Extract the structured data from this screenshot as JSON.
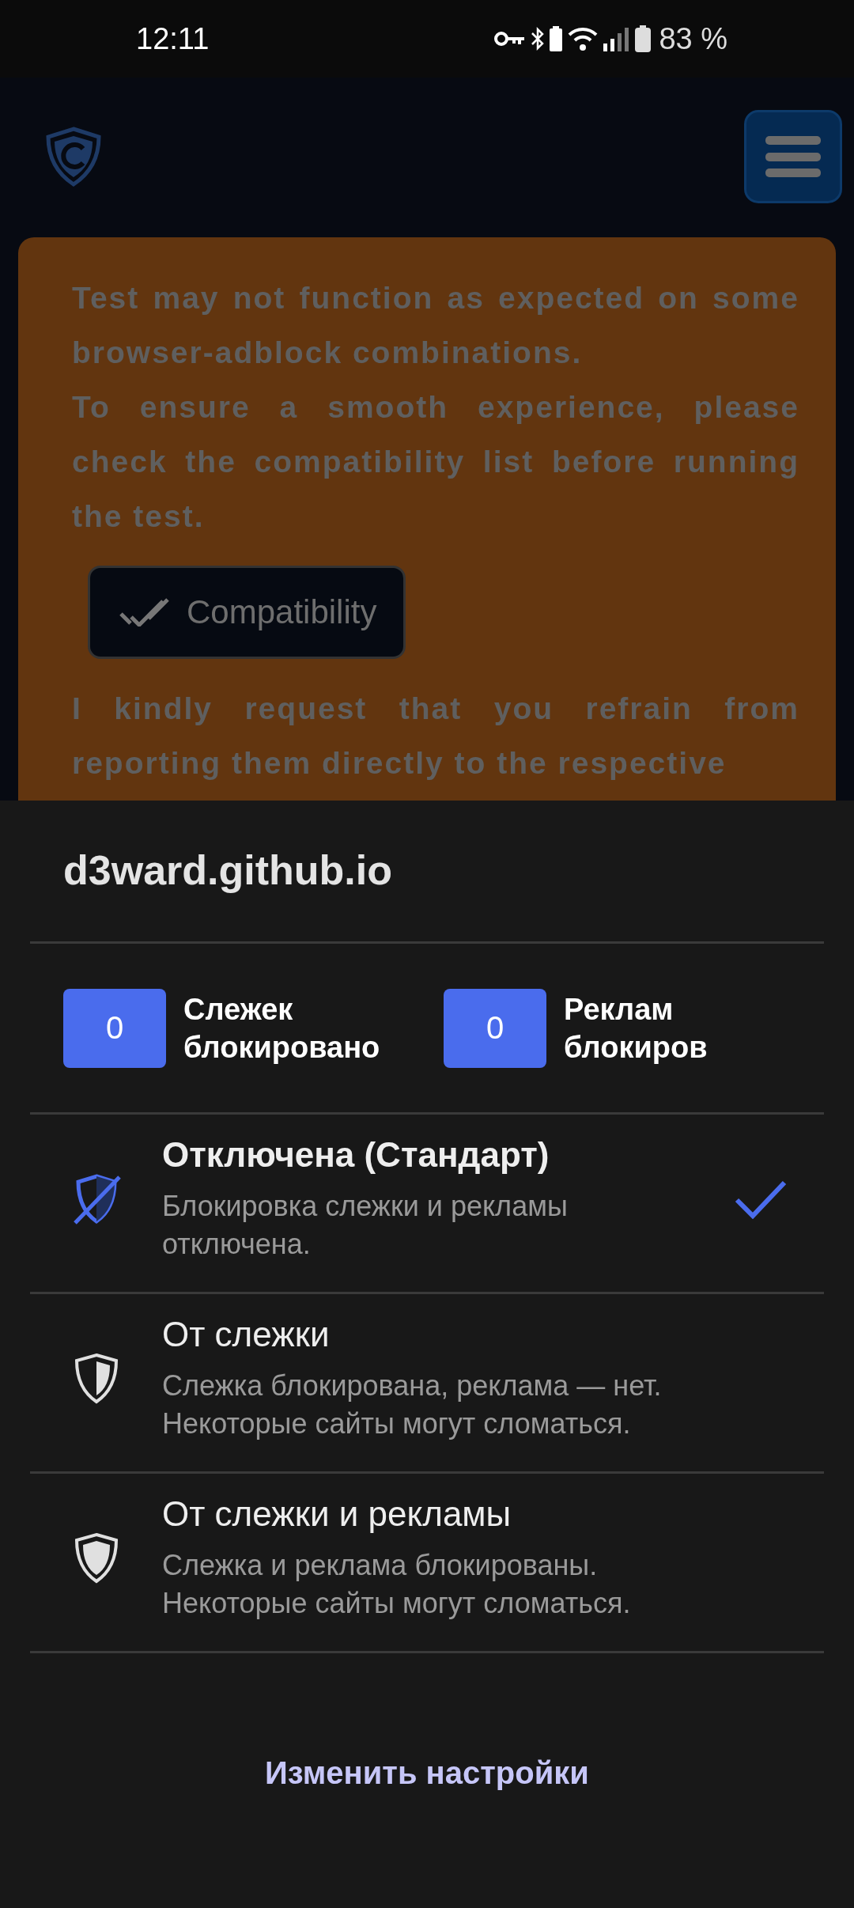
{
  "status_bar": {
    "time": "12:11",
    "battery": "83 %"
  },
  "notice": {
    "paragraphs": [
      "Test may not function as expected on some browser-adblock combinations.",
      "To ensure a smooth experience, please check the compatibility list before running the test."
    ],
    "button": "Compatibility",
    "after": "I kindly request that you refrain from reporting them directly to the respective"
  },
  "sheet": {
    "site": "d3ward.github.io",
    "stats": [
      {
        "count": "0",
        "label": "Слежек блокировано"
      },
      {
        "count": "0",
        "label": "Реклам блокиров"
      }
    ],
    "options": [
      {
        "kind": "off",
        "title": "Отключена (Стандарт)",
        "description": "Блокировка слежки и рекламы отключена.",
        "selected": true
      },
      {
        "kind": "trackers",
        "title": "От слежки",
        "description": "Слежка блокирована, реклама — нет. Некоторые сайты могут сломаться.",
        "selected": false
      },
      {
        "kind": "all",
        "title": "От слежки и рекламы",
        "description": "Слежка и реклама блокированы. Некоторые сайты могут сломаться.",
        "selected": false
      }
    ],
    "action": "Изменить настройки"
  }
}
